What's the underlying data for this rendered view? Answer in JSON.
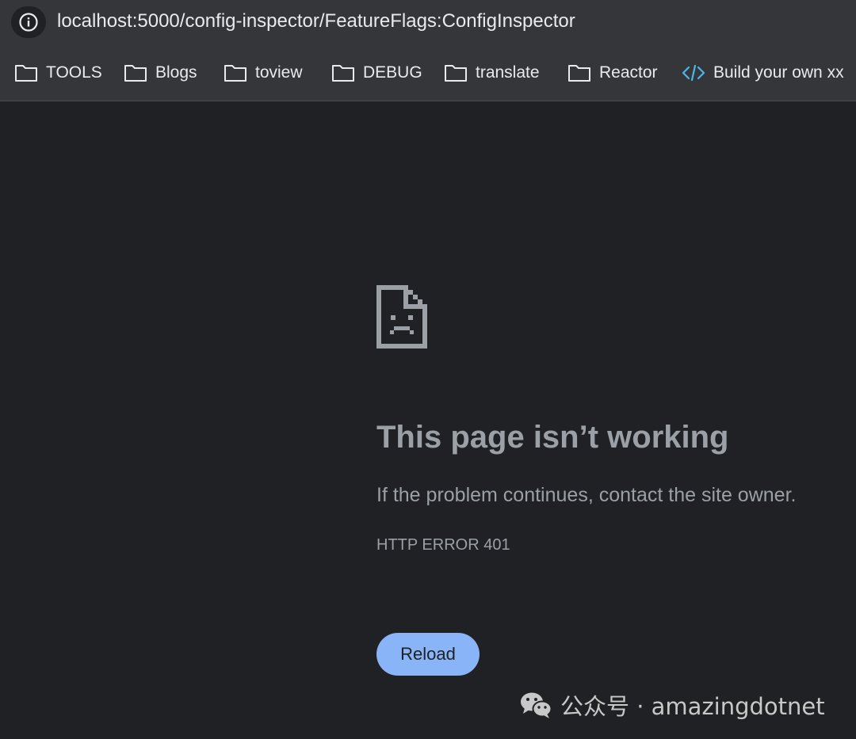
{
  "browser": {
    "url": "localhost:5000/config-inspector/FeatureFlags:ConfigInspector",
    "site_info_icon": "info-icon"
  },
  "bookmarks": [
    {
      "label": "TOOLS",
      "icon": "folder-icon"
    },
    {
      "label": "Blogs",
      "icon": "folder-icon"
    },
    {
      "label": "toview",
      "icon": "folder-icon"
    },
    {
      "label": "DEBUG",
      "icon": "folder-icon"
    },
    {
      "label": "translate",
      "icon": "folder-icon"
    },
    {
      "label": "Reactor",
      "icon": "folder-icon"
    },
    {
      "label": "Build your own xx",
      "icon": "code-icon"
    }
  ],
  "error": {
    "icon": "sad-page-icon",
    "title": "This page isn’t working",
    "message": "If the problem continues, contact the site owner.",
    "code": "HTTP ERROR 401",
    "reload_label": "Reload"
  },
  "watermark": {
    "icon": "wechat-icon",
    "text": "公众号 · amazingdotnet"
  },
  "colors": {
    "page_bg": "#202124",
    "toolbar_bg": "#35363a",
    "text_muted": "#9aa0a6",
    "button_accent": "#8ab4f8",
    "code_icon": "#4db6e8"
  }
}
